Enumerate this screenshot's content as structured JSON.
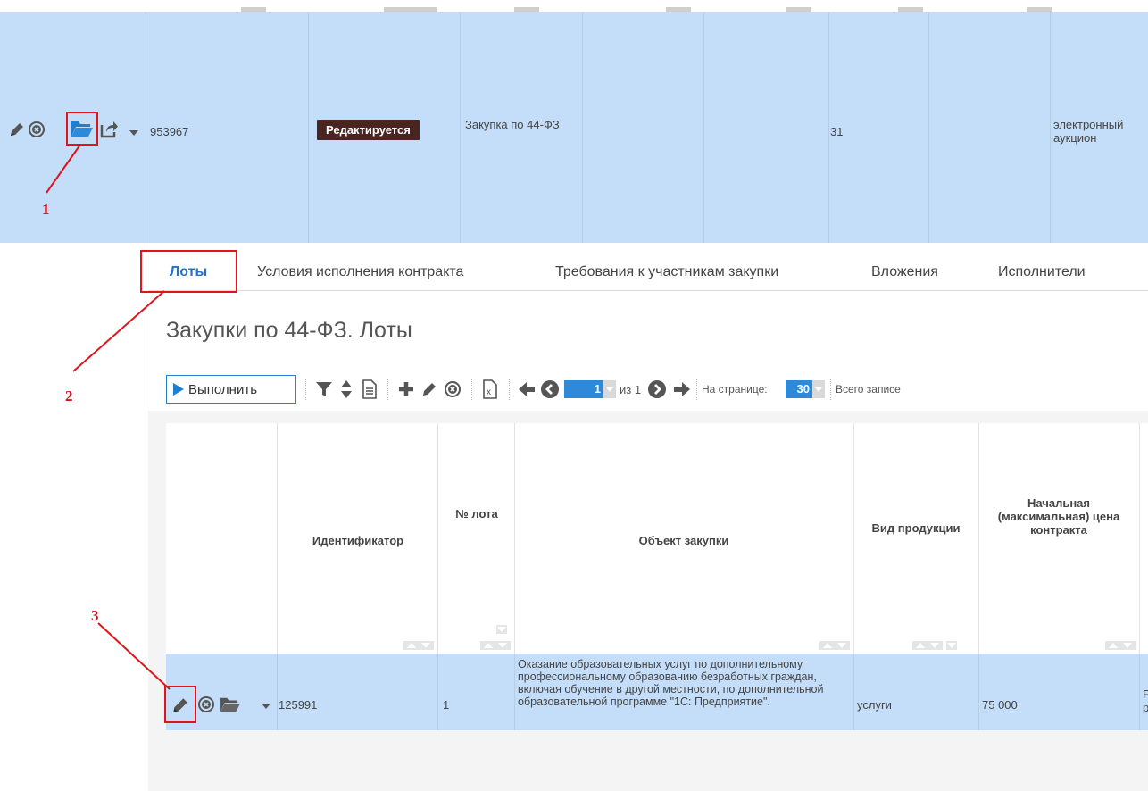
{
  "colors": {
    "row_selected": "#c4defa",
    "accent": "#2e8ad8",
    "badge_bg": "#4a2420",
    "annotation": "#e0151b"
  },
  "outer_row": {
    "id": "953967",
    "status": "Редактируется",
    "type": "Закупка по 44-ФЗ",
    "count": "31",
    "method": "электронный аукцион"
  },
  "annotations": {
    "n1": "1",
    "n2": "2",
    "n3": "3"
  },
  "tabs": [
    {
      "label": "Лоты",
      "active": true
    },
    {
      "label": "Условия исполнения контракта"
    },
    {
      "label": "Требования к участникам закупки"
    },
    {
      "label": "Вложения"
    },
    {
      "label": "Исполнители"
    }
  ],
  "section": {
    "title": "Закупки по 44-ФЗ. Лоты"
  },
  "toolbar": {
    "execute_label": "Выполнить",
    "page_value": "1",
    "page_of": "из 1",
    "per_page_label": "На странице:",
    "per_page_value": "30",
    "total_label": "Всего записе"
  },
  "lots_table": {
    "columns": [
      "Идентификатор",
      "№ лота",
      "Объект закупки",
      "Вид продукции",
      "Начальная (максимальная) цена контракта"
    ],
    "row": {
      "id": "125991",
      "lot": "1",
      "object": "Оказание образовательных услуг по дополнительному профессиональному образованию безработных граждан, включая обучение в другой местности, по дополнительной образовательной программе \"1С: Предприятие\".",
      "kind": "услуги",
      "price": "75 000",
      "cut": "Р р"
    }
  },
  "icons": [
    "pencil-icon",
    "delete-circle-icon",
    "folder-open-icon",
    "share-icon",
    "caret-down-icon",
    "filter-icon",
    "sort-icon",
    "document-icon",
    "plus-icon",
    "excel-icon",
    "arrow-left-icon",
    "circle-left-icon",
    "circle-right-icon",
    "arrow-right-icon",
    "play-icon"
  ]
}
